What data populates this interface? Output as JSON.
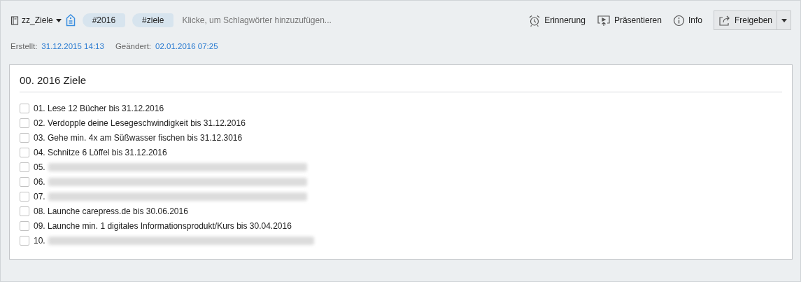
{
  "notebook": {
    "name": "zz_Ziele"
  },
  "tags": [
    "#2016",
    "#ziele"
  ],
  "tag_placeholder": "Klicke, um Schlagwörter hinzuzufügen...",
  "actions": [
    {
      "kind": "alarm",
      "label": "Erinnerung"
    },
    {
      "kind": "present",
      "label": "Präsentieren"
    },
    {
      "kind": "info",
      "label": "Info"
    }
  ],
  "share_button": {
    "label": "Freigeben"
  },
  "meta": [
    {
      "label": "Erstellt:",
      "value": "31.12.2015 14:13"
    },
    {
      "label": "Geändert:",
      "value": "02.01.2016 07:25"
    }
  ],
  "note": {
    "title": "00. 2016 Ziele",
    "items": [
      {
        "kind": "text",
        "label": "01. Lese 12 Bücher bis 31.12.2016",
        "checked": false
      },
      {
        "kind": "text",
        "label": "02. Verdopple deine Lesegeschwindigkeit bis 31.12.2016",
        "checked": false
      },
      {
        "kind": "text",
        "label": "03. Gehe min. 4x am Süßwasser fischen bis 31.12.3016",
        "checked": false
      },
      {
        "kind": "text",
        "label": "04. Schnitze 6 Löffel bis 31.12.2016",
        "checked": false
      },
      {
        "kind": "redacted",
        "label": "05.",
        "checked": false
      },
      {
        "kind": "redacted",
        "label": "06.",
        "checked": false
      },
      {
        "kind": "redacted",
        "label": "07.",
        "checked": false
      },
      {
        "kind": "text",
        "label": "08. Launche carepress.de bis 30.06.2016",
        "checked": false
      },
      {
        "kind": "text",
        "label": "09. Launche min. 1 digitales Informationsprodukt/Kurs bis 30.04.2016",
        "checked": false
      },
      {
        "kind": "redacted",
        "label": "10.",
        "checked": false
      }
    ]
  }
}
